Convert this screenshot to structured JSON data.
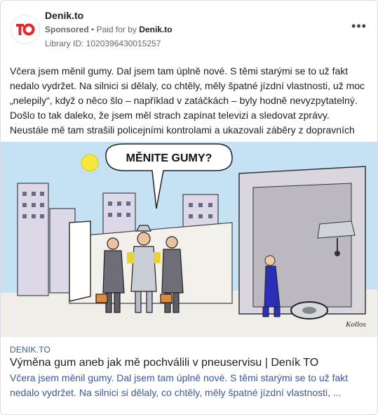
{
  "ad": {
    "page_name": "Denik.to",
    "sponsored": "Sponsored",
    "separator": "•",
    "paid_for_label": "Paid for by",
    "paid_for_name": "Denik.to",
    "library_id": "Library ID: 1020396430015257",
    "more_icon": "more-dots-icon",
    "body": "Včera jsem měnil gumy. Dal jsem tam úplně nové. S těmi starými se to už fakt nedalo vydržet. Na silnici si dělaly, co chtěly, měly špatné jízdní vlastnosti, už moc „nelepily“, když o něco šlo – například v zatáčkách – byly hodně nevyzpytatelný. Došlo to tak daleko, že jsem měl strach zapínat televizi a sledovat zprávy. Neustále mě tam strašili policejními kontrolami a ukazovali záběry z dopravních nehod."
  },
  "cartoon": {
    "speech_bubble": "MĚNITE GUMY?",
    "signature": "Kollos"
  },
  "link": {
    "domain": "DENIK.TO",
    "title": "Výměna gum aneb jak mě pochválili v pneuservisu | Deník TO",
    "description": "Včera jsem měnil gumy. Dal jsem tam úplně nové. S těmi starými se to už fakt nedalo vydržet. Na silnici si dělaly, co chtěly, měly špatné jízdní vlastnosti, ..."
  },
  "colors": {
    "brand_red": "#e4252b",
    "link_blue": "#385898",
    "sky": "#bfe0f2",
    "sun": "#f5e73a"
  }
}
